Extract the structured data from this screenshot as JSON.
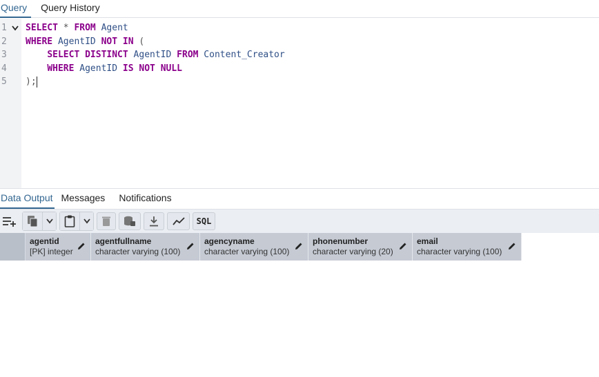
{
  "top_tabs": [
    {
      "label": "Query",
      "active": true
    },
    {
      "label": "Query History",
      "active": false
    }
  ],
  "editor": {
    "lines": [
      {
        "num": "1",
        "tokens": [
          [
            "kw",
            "SELECT"
          ],
          [
            "punc",
            " * "
          ],
          [
            "kw",
            "FROM"
          ],
          [
            "ident",
            " Agent"
          ]
        ],
        "fold": true
      },
      {
        "num": "2",
        "tokens": [
          [
            "kw",
            "WHERE"
          ],
          [
            "ident",
            " AgentID "
          ],
          [
            "kw",
            "NOT IN"
          ],
          [
            "punc",
            " ("
          ]
        ],
        "fold": false
      },
      {
        "num": "3",
        "tokens": [
          [
            "punc",
            "    "
          ],
          [
            "kw",
            "SELECT DISTINCT"
          ],
          [
            "ident",
            " AgentID "
          ],
          [
            "kw",
            "FROM"
          ],
          [
            "ident",
            " Content_Creator"
          ]
        ],
        "fold": false
      },
      {
        "num": "4",
        "tokens": [
          [
            "punc",
            "    "
          ],
          [
            "kw",
            "WHERE"
          ],
          [
            "ident",
            " AgentID "
          ],
          [
            "kw",
            "IS NOT NULL"
          ]
        ],
        "fold": false
      },
      {
        "num": "5",
        "tokens": [
          [
            "punc",
            ");"
          ]
        ],
        "fold": false
      }
    ]
  },
  "output_tabs": [
    {
      "label": "Data Output",
      "active": true
    },
    {
      "label": "Messages",
      "active": false
    },
    {
      "label": "Notifications",
      "active": false
    }
  ],
  "toolbar": {
    "buttons": [
      "add-row-icon",
      "copy-icon",
      "chevron-down-icon",
      "paste-icon",
      "chevron-down-icon",
      "delete-icon",
      "save-data-icon",
      "download-icon",
      "graph-icon",
      "sql-icon"
    ],
    "sql_label": "SQL"
  },
  "columns": [
    {
      "name": "agentid",
      "type": "[PK] integer"
    },
    {
      "name": "agentfullname",
      "type": "character varying (100)"
    },
    {
      "name": "agencyname",
      "type": "character varying (100)"
    },
    {
      "name": "phonenumber",
      "type": "character varying (20)"
    },
    {
      "name": "email",
      "type": "character varying (100)"
    }
  ],
  "colors": {
    "accent": "#326690",
    "keyword": "#8b008b",
    "identifier": "#2f4f86",
    "header_bg": "#c5cad3"
  }
}
